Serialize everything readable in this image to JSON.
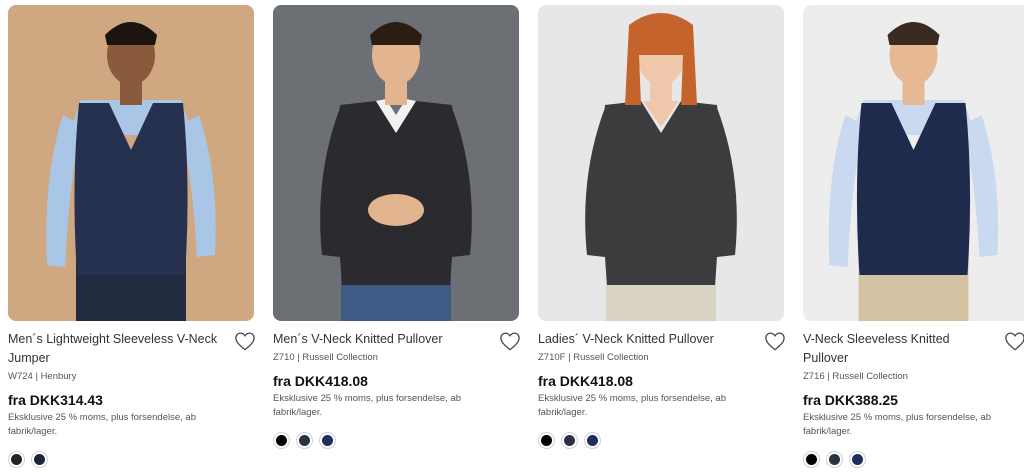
{
  "products": [
    {
      "title": "Men´s Lightweight Sleeveless V-Neck Jumper",
      "meta": "W724 | Henbury",
      "price": "fra DKK314.43",
      "note": "Eksklusive 25 % moms, plus forsendelse, ab fabrik/lager.",
      "favorite_icon": "heart-outline-icon",
      "swatches": [
        "#1e2428",
        "#1c2736"
      ],
      "photo": {
        "background": "#cfa882",
        "garment": "#26304f",
        "shirt": "#a9c6e6",
        "skin": "#8a5a3c",
        "hair": "#1c140e",
        "pants": "#222b3f",
        "style": "vest"
      }
    },
    {
      "title": "Men´s V-Neck Knitted Pullover",
      "meta": "Z710 | Russell Collection",
      "price": "fra DKK418.08",
      "note": "Eksklusive 25 % moms, plus forsendelse, ab fabrik/lager.",
      "favorite_icon": "heart-outline-icon",
      "swatches": [
        "#000000",
        "#2a3240",
        "#1d2f5e"
      ],
      "photo": {
        "background": "#6c6f74",
        "garment": "#2b2b2f",
        "shirt": "#f2f2f2",
        "skin": "#e2b48f",
        "hair": "#2a1d14",
        "pants": "#3f5a84",
        "style": "pullover"
      }
    },
    {
      "title": "Ladies´ V-Neck Knitted Pullover",
      "meta": "Z710F | Russell Collection",
      "price": "fra DKK418.08",
      "note": "Eksklusive 25 % moms, plus forsendelse, ab fabrik/lager.",
      "favorite_icon": "heart-outline-icon",
      "swatches": [
        "#000000",
        "#2a3240",
        "#1d2f5e"
      ],
      "photo": {
        "background": "#e7e7e7",
        "garment": "#3c3c3e",
        "shirt": "#3c3c3e",
        "skin": "#efc7aa",
        "hair": "#c4642c",
        "pants": "#d9d3c6",
        "style": "ladies"
      }
    },
    {
      "title": "V-Neck Sleeveless Knitted Pullover",
      "meta": "Z716 | Russell Collection",
      "price": "fra DKK388.25",
      "note": "Eksklusive 25 % moms, plus forsendelse, ab fabrik/lager.",
      "favorite_icon": "heart-outline-icon",
      "swatches": [
        "#000000",
        "#2a3240",
        "#1d2f5e"
      ],
      "photo": {
        "background": "#ededed",
        "garment": "#1f2b4d",
        "shirt": "#c9d9ef",
        "skin": "#e6b894",
        "hair": "#3a2a1f",
        "pants": "#d3c3a3",
        "style": "vest"
      }
    }
  ]
}
